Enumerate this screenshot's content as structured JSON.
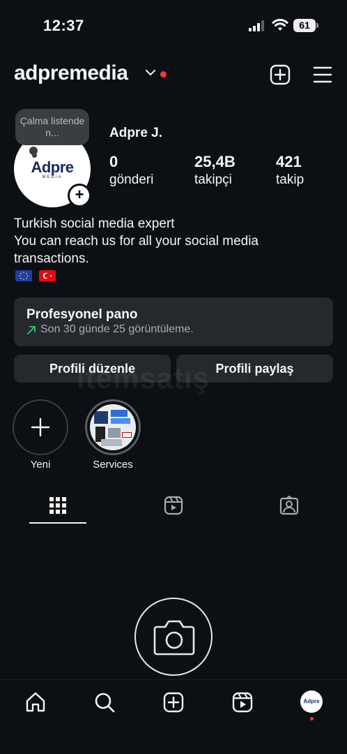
{
  "status": {
    "time": "12:37",
    "battery": "61"
  },
  "header": {
    "username": "adpremedia"
  },
  "avatar": {
    "logo": "Adpre",
    "logo_sub": "MEDIA",
    "note": "Çalma listende n..."
  },
  "profile": {
    "display_name": "Adpre J.",
    "stats": [
      {
        "value": "0",
        "label": "gönderi"
      },
      {
        "value": "25,4B",
        "label": "takipçi"
      },
      {
        "value": "421",
        "label": "takip"
      }
    ],
    "bio": [
      "Turkish social media expert",
      "You can reach us for all your social media",
      "transactions."
    ]
  },
  "dashboard": {
    "title": "Profesyonel pano",
    "subtitle": "Son 30 günde 25 görüntüleme."
  },
  "buttons": {
    "edit": "Profili düzenle",
    "share": "Profili paylaş"
  },
  "watermark": "itemsatış",
  "highlights": [
    {
      "label": "Yeni"
    },
    {
      "label": "Services"
    }
  ],
  "bottom_nav": {
    "avatar_text": "Adpre"
  },
  "colors": {
    "background": "#0c1014",
    "panel": "#25292e",
    "accent_red": "#ff3040",
    "green": "#2ecc71"
  }
}
